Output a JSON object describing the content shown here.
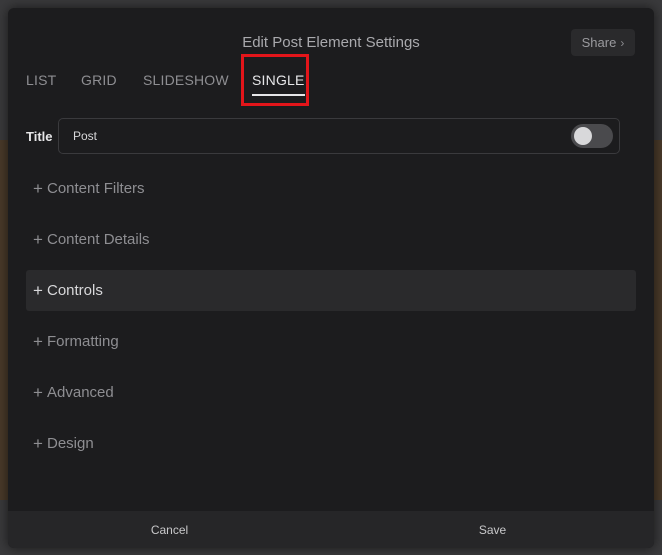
{
  "modal": {
    "title": "Edit Post Element Settings",
    "share_label": "Share",
    "share_icon": "chevron-right-icon"
  },
  "tabs": [
    {
      "label": "LIST",
      "active": false
    },
    {
      "label": "GRID",
      "active": false
    },
    {
      "label": "SLIDESHOW",
      "active": false
    },
    {
      "label": "SINGLE",
      "active": true
    }
  ],
  "title_field": {
    "label": "Title",
    "value": "Post",
    "toggle_on": false
  },
  "sections": [
    {
      "label": "Content Filters"
    },
    {
      "label": "Content Details"
    },
    {
      "label": "Controls",
      "hover": true
    },
    {
      "label": "Formatting"
    },
    {
      "label": "Advanced"
    },
    {
      "label": "Design"
    }
  ],
  "footer": {
    "cancel_label": "Cancel",
    "save_label": "Save"
  },
  "colors": {
    "highlight": "#e3151a",
    "modal_bg": "#1c1c1e"
  }
}
